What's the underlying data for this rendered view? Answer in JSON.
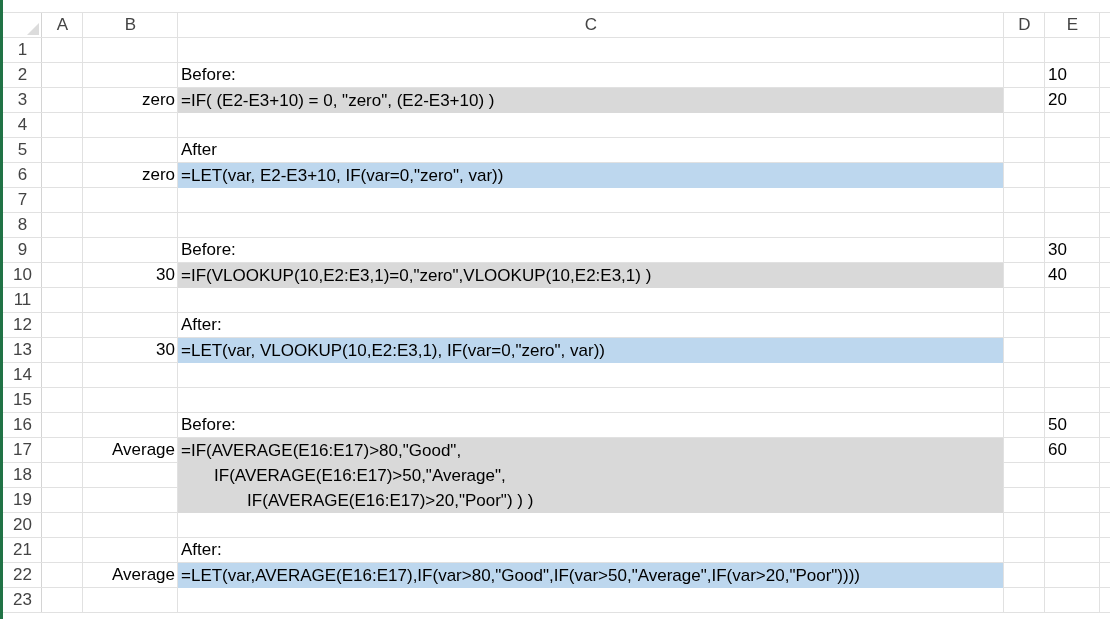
{
  "columns": [
    "A",
    "B",
    "C",
    "D",
    "E"
  ],
  "rows": [
    {
      "num": "1"
    },
    {
      "num": "2",
      "c": "Before:",
      "e": "10"
    },
    {
      "num": "3",
      "b": "zero",
      "c": "=IF( (E2-E3+10) = 0, \"zero\", (E2-E3+10) )",
      "color": "#d9d9d9",
      "e": "20"
    },
    {
      "num": "4"
    },
    {
      "num": "5",
      "c": "After"
    },
    {
      "num": "6",
      "b": "zero",
      "c": "=LET(var, E2-E3+10, IF(var=0,\"zero\", var))",
      "color": "#bdd7ee"
    },
    {
      "num": "7"
    },
    {
      "num": "8"
    },
    {
      "num": "9",
      "c": "Before:",
      "e": "30"
    },
    {
      "num": "10",
      "b": "30",
      "c": "=IF(VLOOKUP(10,E2:E3,1)=0,\"zero\",VLOOKUP(10,E2:E3,1) )",
      "color": "#d9d9d9",
      "e": "40"
    },
    {
      "num": "11"
    },
    {
      "num": "12",
      "c": "After:"
    },
    {
      "num": "13",
      "b": "30",
      "c": "=LET(var, VLOOKUP(10,E2:E3,1), IF(var=0,\"zero\", var))",
      "color": "#bdd7ee"
    },
    {
      "num": "14"
    },
    {
      "num": "15"
    },
    {
      "num": "16",
      "c": "Before:",
      "e": "50"
    },
    {
      "num": "17",
      "b": "Average",
      "c": "=IF(AVERAGE(E16:E17)>80,\"Good\",",
      "color": "#d9d9d9",
      "e": "60"
    },
    {
      "num": "18",
      "c": "       IF(AVERAGE(E16:E17)>50,\"Average\",",
      "color": "#d9d9d9"
    },
    {
      "num": "19",
      "c": "              IF(AVERAGE(E16:E17)>20,\"Poor\") ) )",
      "color": "#d9d9d9"
    },
    {
      "num": "20"
    },
    {
      "num": "21",
      "c": "After:"
    },
    {
      "num": "22",
      "b": "Average",
      "c": "=LET(var,AVERAGE(E16:E17),IF(var>80,\"Good\",IF(var>50,\"Average\",IF(var>20,\"Poor\"))))",
      "color": "#bdd7ee"
    },
    {
      "num": "23"
    }
  ]
}
